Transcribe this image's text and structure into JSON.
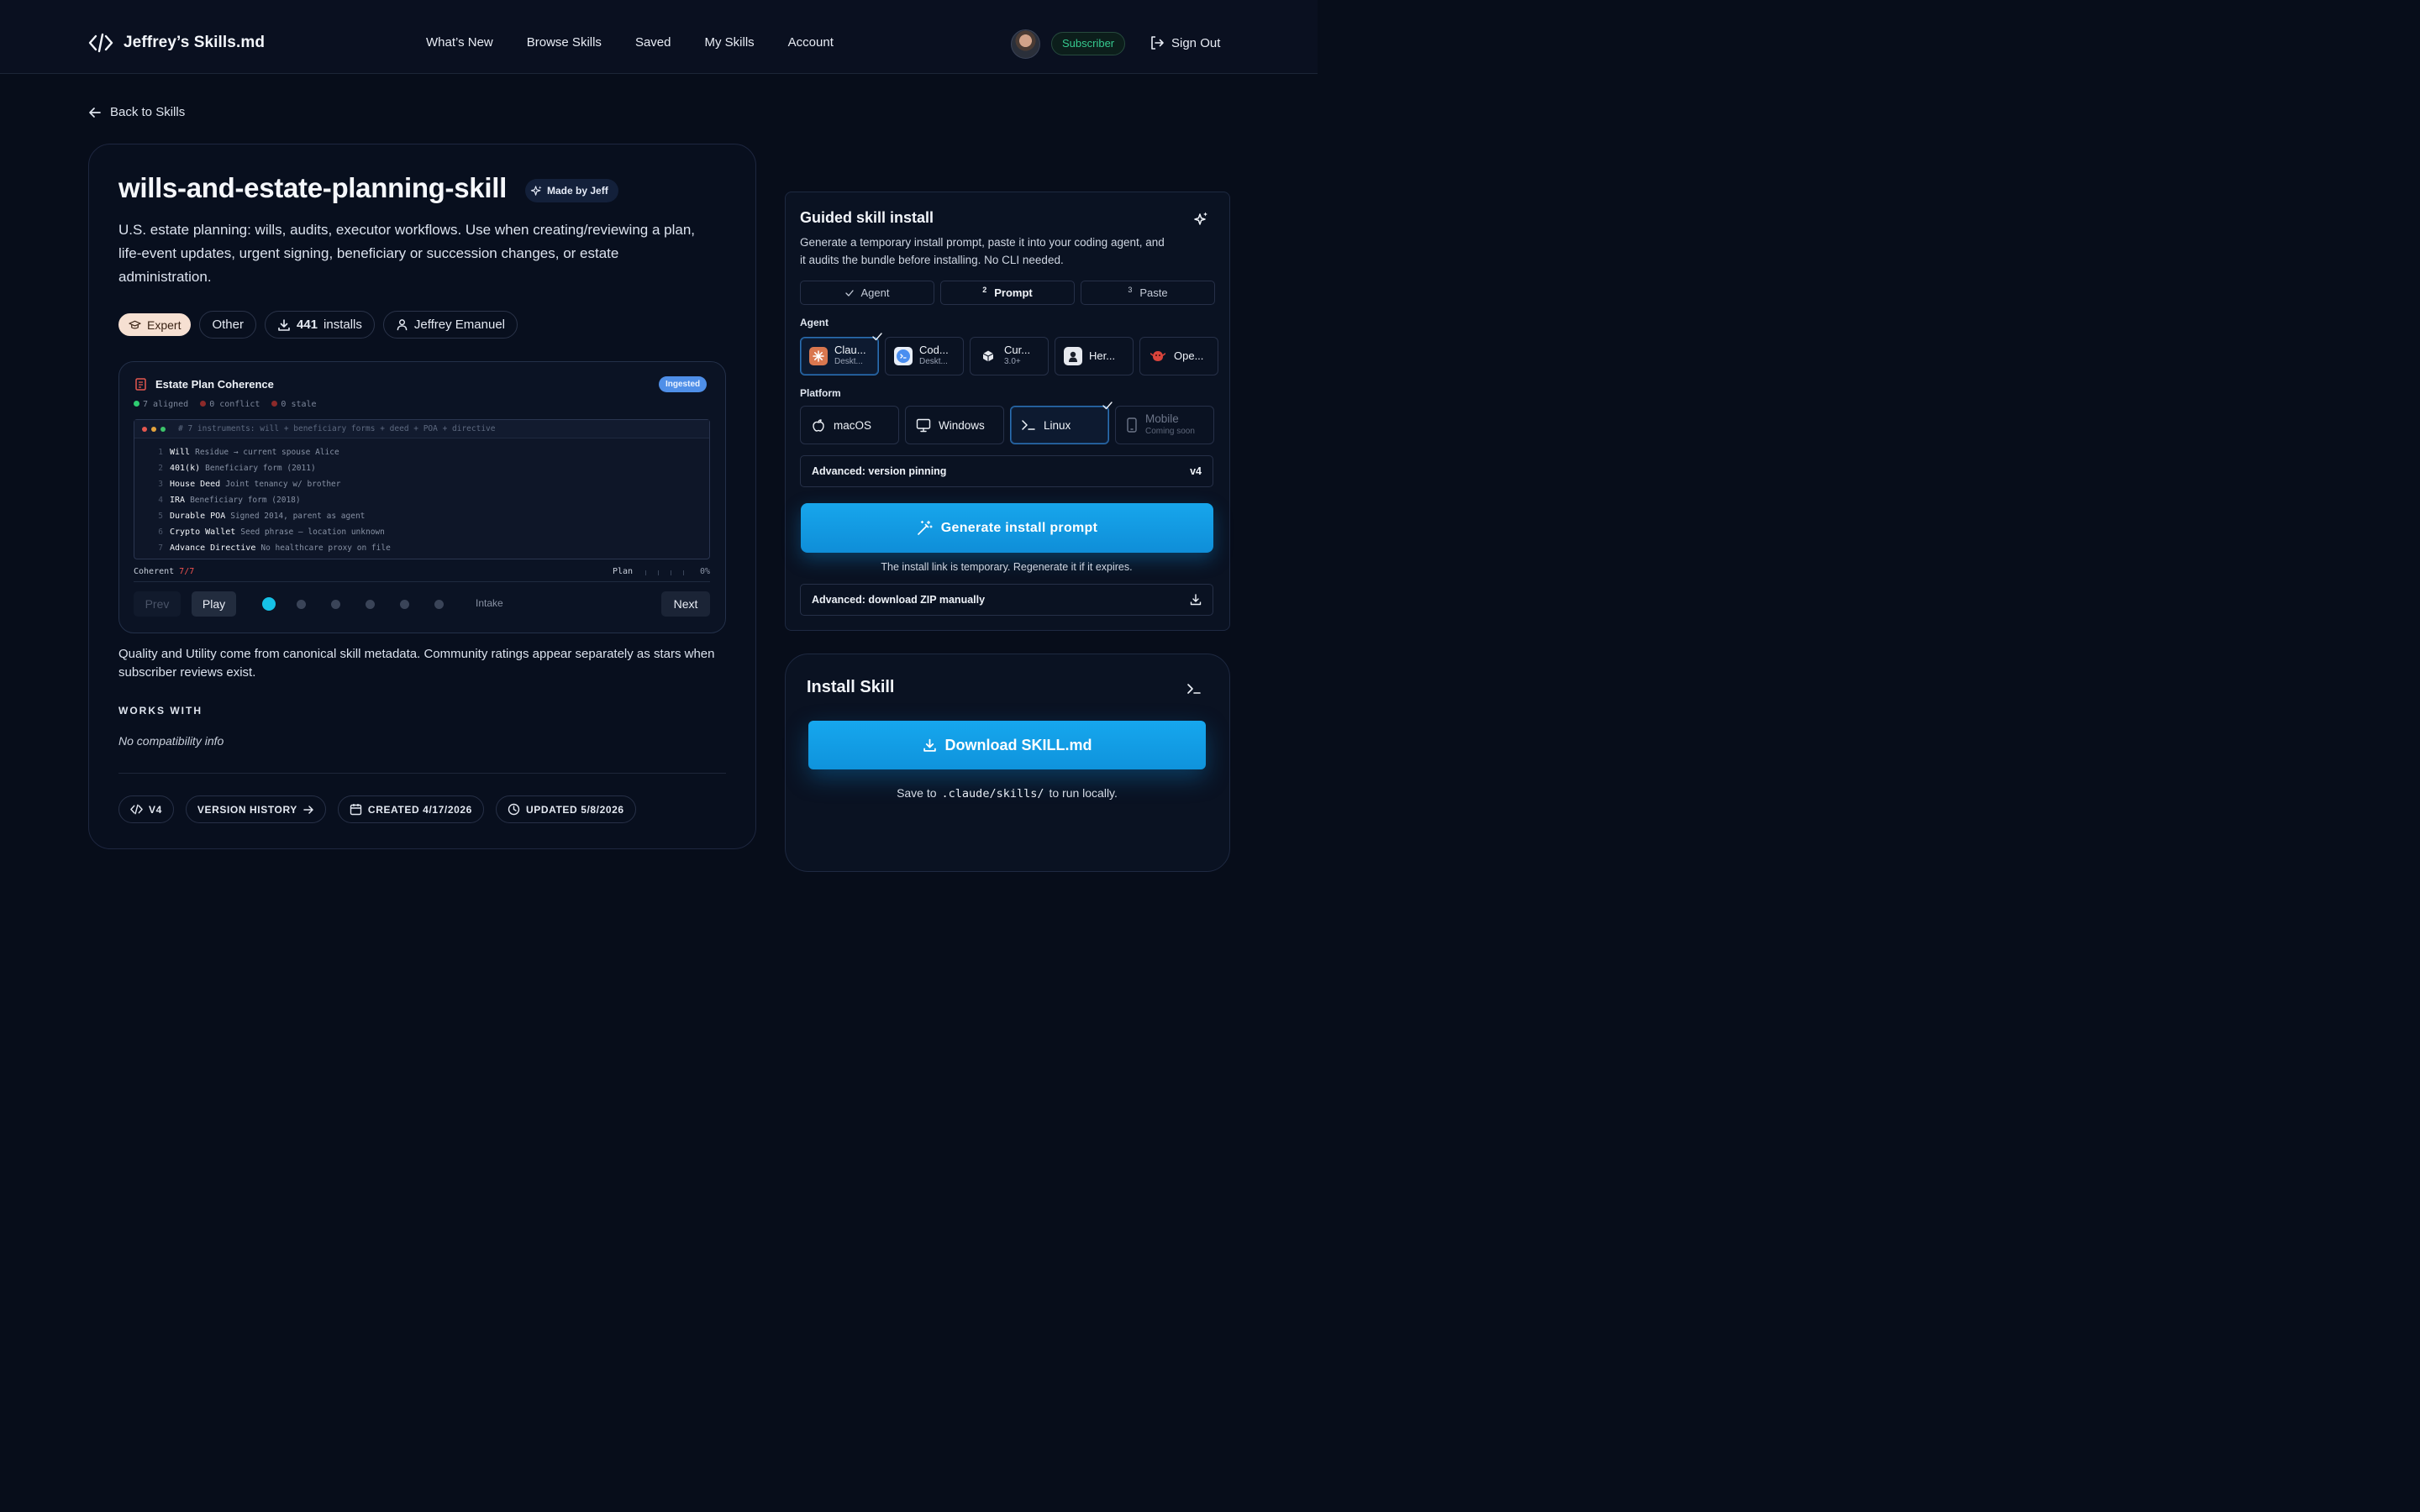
{
  "nav": {
    "brand": "Jeffrey’s Skills.md",
    "links": [
      "What’s New",
      "Browse Skills",
      "Saved",
      "My Skills",
      "Account"
    ],
    "badge": "Subscriber",
    "signout": "Sign Out"
  },
  "back": "Back to Skills",
  "skill": {
    "title": "wills-and-estate-planning-skill",
    "made_by": "Made by Jeff",
    "description": "U.S. estate planning: wills, audits, executor workflows. Use when creating/reviewing a plan, life-event updates, urgent signing, beneficiary or succession changes, or estate administration.",
    "level": "Expert",
    "category": "Other",
    "installs_count": "441",
    "installs_label": "installs",
    "author": "Jeffrey Emanuel"
  },
  "demo": {
    "title": "Estate Plan Coherence",
    "status": "Ingested",
    "stats": [
      {
        "text": "7 aligned",
        "color": "#2ecc71"
      },
      {
        "text": "0 conflict",
        "color": "#8c2a2a"
      },
      {
        "text": "0 stale",
        "color": "#8c2a2a"
      }
    ],
    "code_header": "# 7 instruments: will + beneficiary forms + deed + POA + directive",
    "lines": [
      {
        "n": "1",
        "k": "Will",
        "v": "Residue → current spouse Alice"
      },
      {
        "n": "2",
        "k": "401(k)",
        "v": "Beneficiary form (2011)"
      },
      {
        "n": "3",
        "k": "House Deed",
        "v": "Joint tenancy w/ brother"
      },
      {
        "n": "4",
        "k": "IRA",
        "v": "Beneficiary form (2018)"
      },
      {
        "n": "5",
        "k": "Durable POA",
        "v": "Signed 2014, parent as agent"
      },
      {
        "n": "6",
        "k": "Crypto Wallet",
        "v": "Seed phrase — location unknown"
      },
      {
        "n": "7",
        "k": "Advance Directive",
        "v": "No healthcare proxy on file"
      }
    ],
    "coherent_label": "Coherent",
    "coherent_value": "7/7",
    "plan_label": "Plan",
    "plan_pct": "0%",
    "prev": "Prev",
    "play": "Play",
    "next": "Next",
    "step_label": "Intake",
    "step_count": 6,
    "active_step": 1
  },
  "quality_note": "Quality and Utility come from canonical skill metadata. Community ratings appear separately as stars when subscriber reviews exist.",
  "works_with": {
    "heading": "WORKS WITH",
    "empty": "No compatibility info"
  },
  "meta_chips": {
    "version": "V4",
    "history": "VERSION HISTORY",
    "created": "CREATED 4/17/2026",
    "updated": "UPDATED 5/8/2026"
  },
  "guided": {
    "title": "Guided skill install",
    "description": "Generate a temporary install prompt, paste it into your coding agent, and it audits the bundle before installing. No CLI needed.",
    "steps": [
      {
        "mark": "✓",
        "label": "Agent"
      },
      {
        "mark": "2",
        "label": "Prompt"
      },
      {
        "mark": "3",
        "label": "Paste"
      }
    ],
    "agent_label": "Agent",
    "agents": [
      {
        "name": "Clau...",
        "sub": "Deskt...",
        "color": "#d9774f"
      },
      {
        "name": "Cod...",
        "sub": "Deskt...",
        "color": "#4a8ef0"
      },
      {
        "name": "Cur...",
        "sub": "3.0+",
        "color": "#e6e9ef"
      },
      {
        "name": "Her...",
        "sub": "",
        "color": "#e6e9ef"
      },
      {
        "name": "Ope...",
        "sub": "",
        "color": "#d9443c"
      }
    ],
    "platform_label": "Platform",
    "platforms": [
      {
        "name": "macOS",
        "sub": ""
      },
      {
        "name": "Windows",
        "sub": ""
      },
      {
        "name": "Linux",
        "sub": ""
      },
      {
        "name": "Mobile",
        "sub": "Coming soon"
      }
    ],
    "version_pin_label": "Advanced: version pinning",
    "version_pin_value": "v4",
    "generate": "Generate install prompt",
    "generate_note": "The install link is temporary. Regenerate it if it expires.",
    "zip_label": "Advanced: download ZIP manually"
  },
  "install": {
    "title": "Install Skill",
    "button": "Download SKILL.md",
    "note_pre": "Save to",
    "note_path": ".claude/skills/",
    "note_post": "to run locally."
  },
  "colors": {
    "accent": "#0f93dc",
    "badge_green": "#36c98f",
    "step_active": "#16c1e6"
  }
}
